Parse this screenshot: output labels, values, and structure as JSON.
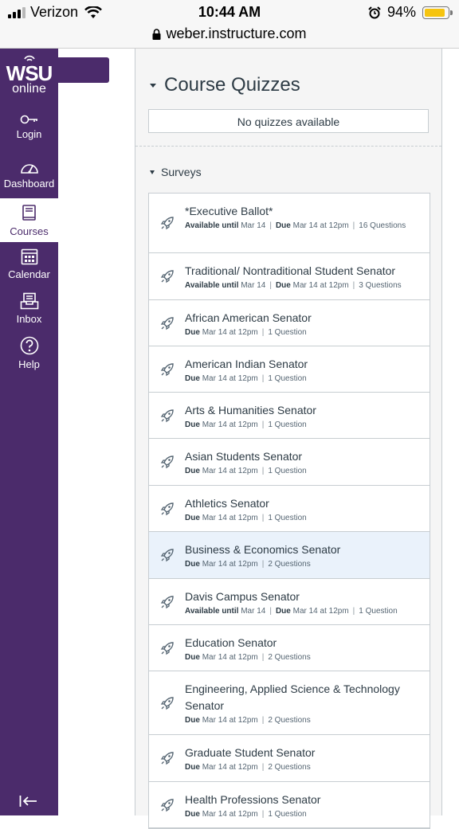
{
  "statusbar": {
    "carrier": "Verizon",
    "time": "10:44 AM",
    "battery": "94%",
    "battery_level": 0.94
  },
  "urlbar": {
    "url": "weber.instructure.com"
  },
  "logo": {
    "line1": "WSU",
    "line2": "online"
  },
  "nav": [
    {
      "label": "Login",
      "icon": "key-icon"
    },
    {
      "label": "Dashboard",
      "icon": "dashboard-icon"
    },
    {
      "label": "Courses",
      "icon": "book-icon"
    },
    {
      "label": "Calendar",
      "icon": "calendar-icon"
    },
    {
      "label": "Inbox",
      "icon": "inbox-icon"
    },
    {
      "label": "Help",
      "icon": "help-icon"
    }
  ],
  "main": {
    "course_quizzes_title": "Course Quizzes",
    "no_quizzes": "No quizzes available",
    "surveys_title": "Surveys"
  },
  "labels": {
    "available_until": "Available until",
    "due": "Due"
  },
  "surveys": [
    {
      "title": "*Executive Ballot*",
      "available_until": "Mar 14",
      "due": "Mar 14 at 12pm",
      "questions": "16 Questions"
    },
    {
      "title": "Traditional/ Nontraditional Student Senator",
      "available_until": "Mar 14",
      "due": "Mar 14 at 12pm",
      "questions": "3 Questions"
    },
    {
      "title": "African American Senator",
      "due": "Mar 14 at 12pm",
      "questions": "1 Question"
    },
    {
      "title": "American Indian Senator",
      "due": "Mar 14 at 12pm",
      "questions": "1 Question"
    },
    {
      "title": "Arts & Humanities Senator",
      "due": "Mar 14 at 12pm",
      "questions": "1 Question"
    },
    {
      "title": "Asian Students Senator",
      "due": "Mar 14 at 12pm",
      "questions": "1 Question"
    },
    {
      "title": "Athletics Senator",
      "due": "Mar 14 at 12pm",
      "questions": "1 Question"
    },
    {
      "title": "Business & Economics Senator",
      "due": "Mar 14 at 12pm",
      "questions": "2 Questions",
      "highlighted": true
    },
    {
      "title": "Davis Campus Senator",
      "available_until": "Mar 14",
      "due": "Mar 14 at 12pm",
      "questions": "1 Question"
    },
    {
      "title": "Education Senator",
      "due": "Mar 14 at 12pm",
      "questions": "2 Questions"
    },
    {
      "title": "Engineering, Applied Science & Technology Senator",
      "due": "Mar 14 at 12pm",
      "questions": "2 Questions"
    },
    {
      "title": "Graduate Student Senator",
      "due": "Mar 14 at 12pm",
      "questions": "2 Questions"
    },
    {
      "title": "Health Professions Senator",
      "due": "Mar 14 at 12pm",
      "questions": "1 Question"
    }
  ],
  "colors": {
    "brand_purple": "#4b2b6b",
    "text": "#2d3b45",
    "highlight": "#eaf2fb"
  }
}
